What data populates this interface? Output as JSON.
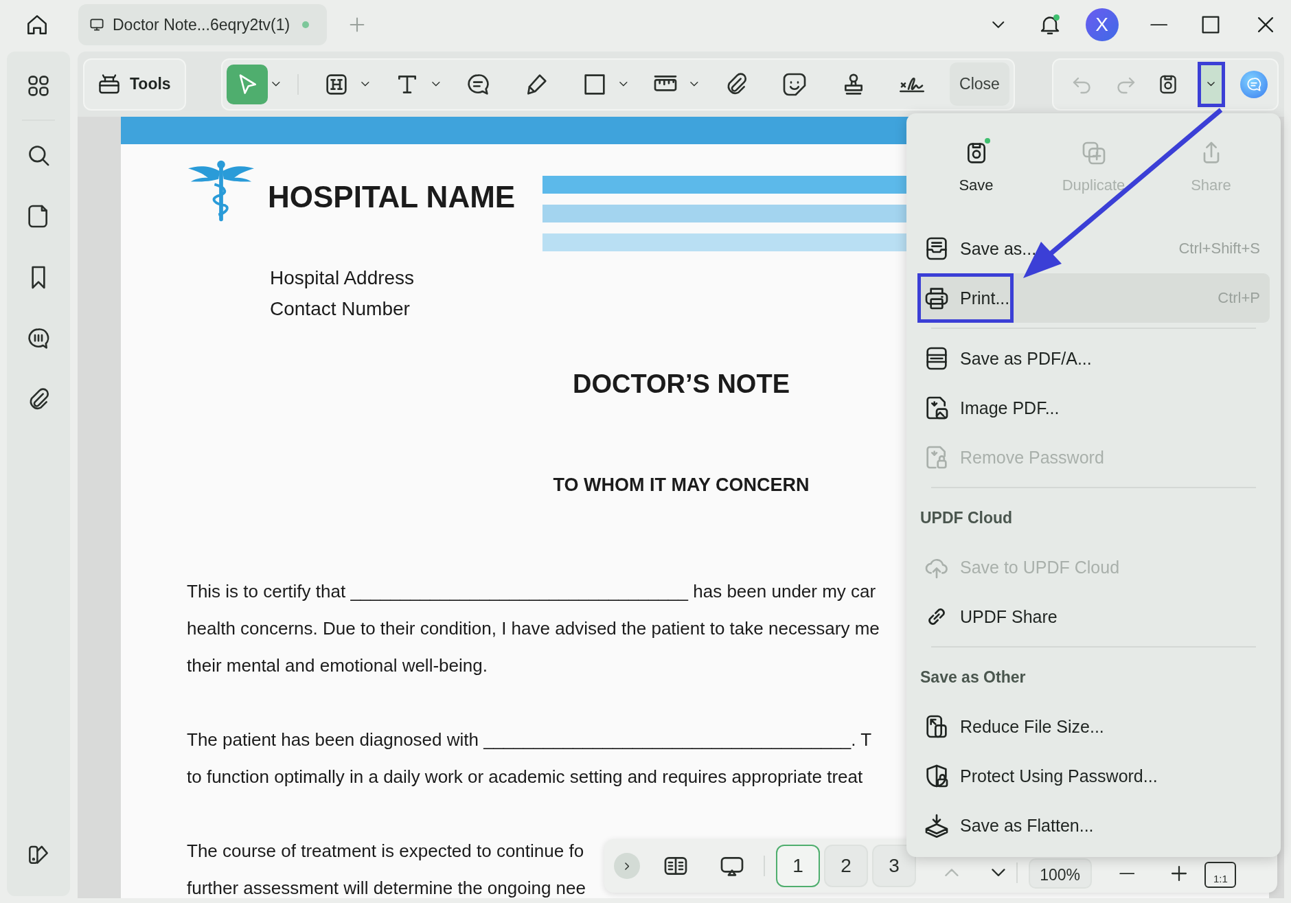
{
  "titlebar": {
    "tab": {
      "title": "Doctor Note...6eqry2tv(1)",
      "unsaved": true
    },
    "notification_dot": true,
    "avatar": "X"
  },
  "sidebar": {
    "items": [
      {
        "kind": "thumbnails"
      },
      {
        "kind": "search"
      },
      {
        "kind": "pages"
      },
      {
        "kind": "bookmarks"
      },
      {
        "kind": "comments"
      },
      {
        "kind": "attachments"
      }
    ],
    "footer": [
      {
        "kind": "theme"
      }
    ]
  },
  "toolbar": {
    "tools_button": "Tools",
    "tools": [
      {
        "kind": "select",
        "selected": true,
        "dropdown": true
      },
      {
        "kind": "heading",
        "selected": false,
        "dropdown": true
      },
      {
        "kind": "text",
        "selected": false,
        "dropdown": true
      },
      {
        "kind": "comment",
        "selected": false,
        "dropdown": false
      },
      {
        "kind": "pen",
        "selected": false,
        "dropdown": false
      },
      {
        "kind": "shape",
        "selected": false,
        "dropdown": true
      },
      {
        "kind": "measure",
        "selected": false,
        "dropdown": true
      },
      {
        "kind": "attach",
        "selected": false,
        "dropdown": false
      },
      {
        "kind": "sticker",
        "selected": false,
        "dropdown": false
      },
      {
        "kind": "stamp",
        "selected": false,
        "dropdown": false
      },
      {
        "kind": "signature",
        "selected": false,
        "dropdown": false
      }
    ],
    "close_button": "Close",
    "actions": [
      {
        "kind": "undo",
        "disabled": true,
        "annotated": false
      },
      {
        "kind": "redo",
        "disabled": true,
        "annotated": false
      },
      {
        "kind": "save",
        "disabled": false,
        "annotated": false
      },
      {
        "kind": "caret",
        "disabled": false,
        "annotated": true
      },
      {
        "kind": "ai",
        "annotated": false
      }
    ]
  },
  "document": {
    "hospital_name": "HOSPITAL NAME",
    "address_lines": [
      "Hospital Address",
      "Contact Number"
    ],
    "title": "DOCTOR’S NOTE",
    "salutation": "TO WHOM IT MAY CONCERN",
    "paragraphs": [
      [
        "This is to certify that __________________________________ has been under my car",
        "health concerns. Due to their condition, I have advised the patient to take necessary me",
        "their mental and emotional well-being."
      ],
      [
        "The patient has been diagnosed with _____________________________________. T",
        "to function optimally in a daily work or academic setting and requires appropriate treat"
      ],
      [
        "The course of treatment is expected to continue fo",
        "further assessment will determine the ongoing nee"
      ]
    ]
  },
  "save_menu": {
    "top": [
      {
        "kind": "save",
        "label": "Save",
        "disabled": false,
        "modified": true
      },
      {
        "kind": "duplicate",
        "label": "Duplicate",
        "disabled": true,
        "modified": false
      },
      {
        "kind": "share",
        "label": "Share",
        "disabled": true,
        "modified": false
      }
    ],
    "items": [
      {
        "kind": "save-as",
        "label": "Save as...",
        "shortcut": "Ctrl+Shift+S",
        "disabled": false,
        "highlighted": false,
        "annotated": false
      },
      {
        "kind": "print",
        "label": "Print...",
        "shortcut": "Ctrl+P",
        "disabled": false,
        "highlighted": true,
        "annotated": true
      },
      {
        "kind": "divider"
      },
      {
        "kind": "pdfa",
        "label": "Save as PDF/A...",
        "disabled": false,
        "highlighted": false,
        "annotated": false
      },
      {
        "kind": "image-pdf",
        "label": "Image PDF...",
        "disabled": false,
        "highlighted": false,
        "annotated": false
      },
      {
        "kind": "remove-password",
        "label": "Remove Password",
        "disabled": true,
        "highlighted": false,
        "annotated": false
      },
      {
        "kind": "divider"
      },
      {
        "kind": "header",
        "label": "UPDF Cloud"
      },
      {
        "kind": "cloud",
        "label": "Save to UPDF Cloud",
        "disabled": true,
        "highlighted": false,
        "annotated": false
      },
      {
        "kind": "link",
        "label": "UPDF Share",
        "disabled": false,
        "highlighted": false,
        "annotated": false
      },
      {
        "kind": "divider"
      },
      {
        "kind": "header",
        "label": "Save as Other"
      },
      {
        "kind": "reduce",
        "label": "Reduce File Size...",
        "disabled": false,
        "highlighted": false,
        "annotated": false
      },
      {
        "kind": "protect",
        "label": "Protect Using Password...",
        "disabled": false,
        "highlighted": false,
        "annotated": false
      },
      {
        "kind": "flatten",
        "label": "Save as Flatten...",
        "disabled": false,
        "highlighted": false,
        "annotated": false
      }
    ]
  },
  "page_nav": {
    "pages": [
      {
        "label": "1",
        "selected": true
      },
      {
        "label": "2",
        "selected": false
      },
      {
        "label": "3",
        "selected": false
      }
    ],
    "previous_disabled": true,
    "zoom": "100%",
    "actual_size": "1:1"
  },
  "arrow_annotation": true
}
